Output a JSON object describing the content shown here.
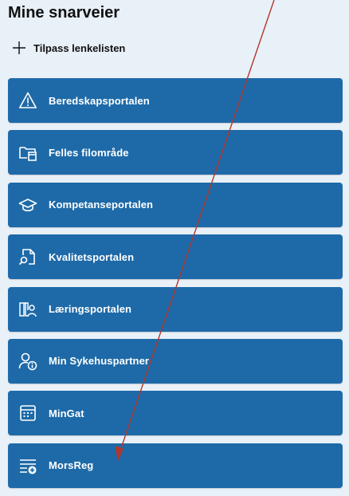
{
  "panel": {
    "title": "Mine snarveier",
    "customize_label": "Tilpass lenkelisten",
    "customize_icon": "plus-icon"
  },
  "shortcuts": [
    {
      "label": "Beredskapsportalen",
      "icon": "warning-icon"
    },
    {
      "label": "Felles filområde",
      "icon": "folder-files-icon"
    },
    {
      "label": "Kompetanseportalen",
      "icon": "graduation-cap-icon"
    },
    {
      "label": "Kvalitetsportalen",
      "icon": "document-search-icon"
    },
    {
      "label": "Læringsportalen",
      "icon": "book-person-icon"
    },
    {
      "label": "Min Sykehuspartner",
      "icon": "person-info-icon"
    },
    {
      "label": "MinGat",
      "icon": "calendar-grid-icon"
    },
    {
      "label": "MorsReg",
      "icon": "list-add-icon"
    }
  ],
  "colors": {
    "tile": "#1e6aa8",
    "panel_background": "#e8f0f8",
    "annotation_arrow": "#b3362b"
  }
}
